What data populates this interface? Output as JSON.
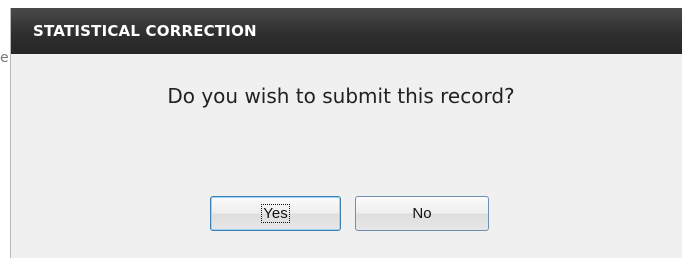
{
  "background": {
    "fragment": "e"
  },
  "dialog": {
    "title": "STATISTICAL CORRECTION",
    "message": "Do you wish to submit this record?",
    "buttons": {
      "yes": "Yes",
      "no": "No"
    }
  }
}
